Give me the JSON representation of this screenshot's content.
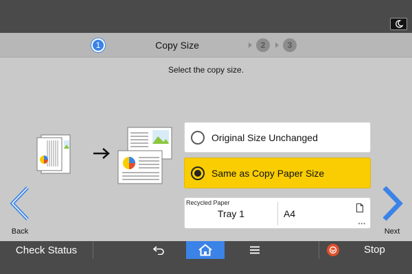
{
  "header": {
    "sleep_icon": "moon-icon"
  },
  "steps": {
    "current_number": "1",
    "title": "Copy Size",
    "step2_number": "2",
    "step3_number": "3"
  },
  "instruction": "Select the copy size.",
  "options": [
    {
      "label": "Original Size Unchanged",
      "selected": false
    },
    {
      "label": "Same as Copy Paper Size",
      "selected": true
    }
  ],
  "tray": {
    "paper_type": "Recycled Paper",
    "name": "Tray 1",
    "size": "A4",
    "more": "•••"
  },
  "navigation": {
    "back_label": "Back",
    "next_label": "Next"
  },
  "bottom_bar": {
    "check_status_label": "Check Status",
    "stop_label": "Stop"
  },
  "colors": {
    "accent_blue": "#3b83e6",
    "selected_yellow": "#f9cd02",
    "stop_red": "#e2502a",
    "bar_dark": "#4a4a4a",
    "background": "#c9c9c9"
  }
}
